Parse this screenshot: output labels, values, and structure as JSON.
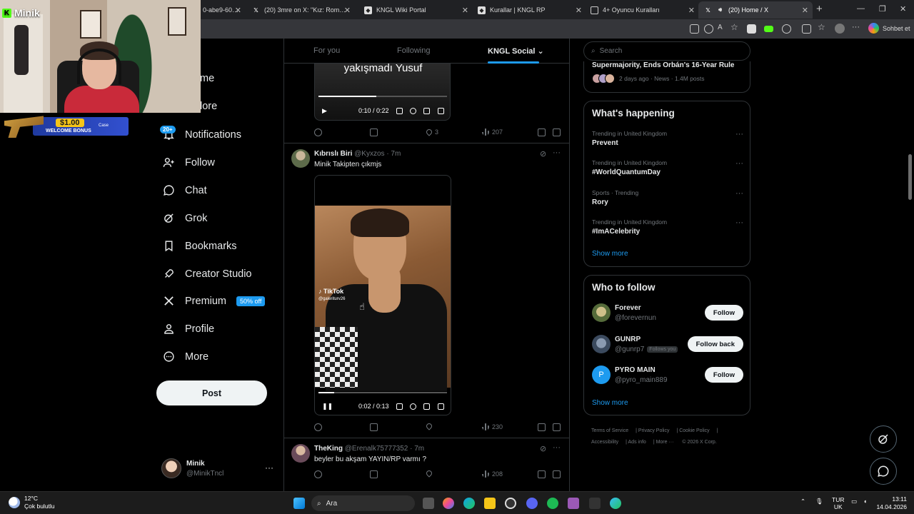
{
  "browser": {
    "tabs": [
      {
        "title": "0-abe9-60c7c",
        "favicon": "generic-icon",
        "active": false
      },
      {
        "title": "(20) 3mre on X: \"Kız: Romantik erk",
        "favicon": "x-icon",
        "active": false
      },
      {
        "title": "KNGL Wiki Portal",
        "favicon": "shield-icon",
        "active": false
      },
      {
        "title": "Kurallar | KNGL RP",
        "favicon": "shield-icon",
        "active": false
      },
      {
        "title": "4+ Oyuncu Kuralları",
        "favicon": "doc-icon",
        "active": false
      },
      {
        "title": "(20) Home / X",
        "favicon": "x-icon",
        "active": true
      }
    ],
    "copilot_label": "Sohbet et"
  },
  "stream": {
    "brand": "Minik",
    "bonus_amount": "$1.00",
    "bonus_text": "WELCOME BONUS",
    "bonus_brand": "Case"
  },
  "nav": {
    "items": [
      {
        "label": "Home",
        "icon": "home-icon"
      },
      {
        "label": "Explore",
        "icon": "search-icon"
      },
      {
        "label": "Notifications",
        "icon": "bell-icon",
        "badge": "20+"
      },
      {
        "label": "Follow",
        "icon": "person-plus-icon"
      },
      {
        "label": "Chat",
        "icon": "chat-icon"
      },
      {
        "label": "Grok",
        "icon": "grok-icon"
      },
      {
        "label": "Bookmarks",
        "icon": "bookmark-icon"
      },
      {
        "label": "Creator Studio",
        "icon": "rocket-icon"
      },
      {
        "label": "Premium",
        "icon": "x-icon",
        "pill": "50% off"
      },
      {
        "label": "Profile",
        "icon": "person-icon"
      },
      {
        "label": "More",
        "icon": "more-circle-icon"
      }
    ],
    "partial": {
      "home": "me",
      "explore": "lore"
    },
    "post_label": "Post",
    "account": {
      "name": "Minik",
      "handle": "@MinikTncl"
    }
  },
  "timeline": {
    "tabs": [
      "For you",
      "Following",
      "KNGL Social"
    ],
    "top_post": {
      "caption": "yakışmadı Yusuf",
      "video_time": "0:10 / 0:22",
      "video_progress": 0.45,
      "likes": "3",
      "views": "207"
    },
    "posts": [
      {
        "name": "Kıbrıslı Biri",
        "handle": "@Kyxzos",
        "time": "· 7m",
        "text": "Minik Takipten çıkmjs",
        "video": {
          "watermark": "TikTok",
          "watermark_handle": "@galeriturv26",
          "time": "0:02 / 0:13",
          "progress": 0.12
        },
        "views": "230"
      },
      {
        "name": "TheKing",
        "handle": "@Erenalk75777352",
        "time": "· 7m",
        "text": "beyler bu akşam YAYIN/RP varmı ?",
        "views": "208"
      }
    ]
  },
  "sidebar": {
    "search_placeholder": "Search",
    "news": {
      "title": "Supermajority, Ends Orbán's 16-Year Rule",
      "meta": "2 days ago · News · 1.4M posts"
    },
    "happening_title": "What's happening",
    "trends": [
      {
        "context": "Trending in United Kingdom",
        "topic": "Prevent"
      },
      {
        "context": "Trending in United Kingdom",
        "topic": "#WorldQuantumDay"
      },
      {
        "context": "Sports · Trending",
        "topic": "Rory"
      },
      {
        "context": "Trending in United Kingdom",
        "topic": "#ImACelebrity"
      }
    ],
    "show_more": "Show more",
    "who_title": "Who to follow",
    "who": [
      {
        "name": "Forever",
        "handle": "@forevernun",
        "button": "Follow",
        "follows_you": ""
      },
      {
        "name": "GUNRP",
        "handle": "@gunrp7",
        "button": "Follow back",
        "follows_you": "Follows you"
      },
      {
        "name": "PYRO MAIN",
        "handle": "@pyro_main889",
        "button": "Follow",
        "follows_you": "",
        "initial": "P"
      }
    ],
    "footer": [
      "Terms of Service",
      "Privacy Policy",
      "Cookie Policy",
      "Accessibility",
      "Ads info",
      "More ···",
      "© 2026 X Corp."
    ]
  },
  "taskbar": {
    "weather_temp": "12°C",
    "weather_desc": "Çok bulutlu",
    "search_label": "Ara",
    "lang_top": "TUR",
    "lang_bottom": "UK",
    "time": "13:11",
    "date": "14.04.2026"
  },
  "colors": {
    "accent": "#1d9bf0",
    "bg": "#000000",
    "text": "#e7e9ea",
    "muted": "#71767b"
  }
}
